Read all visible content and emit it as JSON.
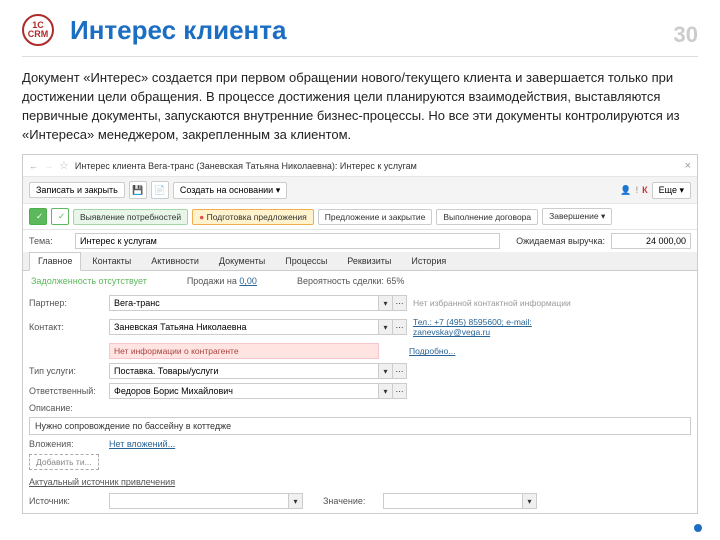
{
  "slide": {
    "logo": "1C CRM",
    "title": "Интерес клиента",
    "page": "30",
    "description": "Документ «Интерес» создается при первом обращении нового/текущего клиента и завершается только при достижении цели обращения. В процессе достижения цели планируются взаимодействия, выставляются первичные документы, запускаются внутренние бизнес-процессы. Но все эти документы контролируются из «Интереса» менеджером, закрепленным за клиентом."
  },
  "crm": {
    "window_title": "Интерес клиента Вега-транс (Заневская Татьяна Николаевна): Интерес к услугам",
    "toolbar": {
      "save_close": "Записать и закрыть",
      "create_based": "Создать на основании",
      "more": "Еще",
      "k": "К"
    },
    "stages": {
      "s1": "Выявление потребностей",
      "s2": "Подготовка предложения",
      "s3": "Предложение и закрытие",
      "s4": "Выполнение договора",
      "s5": "Завершение"
    },
    "topic": {
      "label": "Тема:",
      "value": "Интерес к услугам"
    },
    "revenue": {
      "label": "Ожидаемая выручка:",
      "value": "24 000,00"
    },
    "tabs": {
      "t1": "Главное",
      "t2": "Контакты",
      "t3": "Активности",
      "t4": "Документы",
      "t5": "Процессы",
      "t6": "Реквизиты",
      "t7": "История"
    },
    "info_bar": {
      "debt": "Задолженность отсутствует",
      "sales": "Продажи на",
      "sales_val": "0,00",
      "prob": "Вероятность сделки: 65%"
    },
    "fields": {
      "partner": {
        "label": "Партнер:",
        "value": "Вега-транс"
      },
      "contact": {
        "label": "Контакт:",
        "value": "Заневская Татьяна Николаевна"
      },
      "warn": "Нет информации о контрагенте",
      "more": "Подробно...",
      "type": {
        "label": "Тип услуги:",
        "value": "Поставка. Товары/услуги"
      },
      "resp": {
        "label": "Ответственный:",
        "value": "Федоров Борис Михайлович"
      },
      "desc_label": "Описание:",
      "desc_value": "Нужно сопровождение по бассейну в коттедже",
      "attach_label": "Вложения:",
      "attach_link": "Нет вложений...",
      "add_file": "Добавить ти..."
    },
    "side": {
      "no_contact": "Нет избранной контактной информации",
      "phone": "Тел.: +7 (495) 8595600; e-mail: zanevskay@vega.ru"
    },
    "source": {
      "header": "Актуальный источник привлечения",
      "src_label": "Источник:",
      "val_label": "Значение:"
    }
  }
}
